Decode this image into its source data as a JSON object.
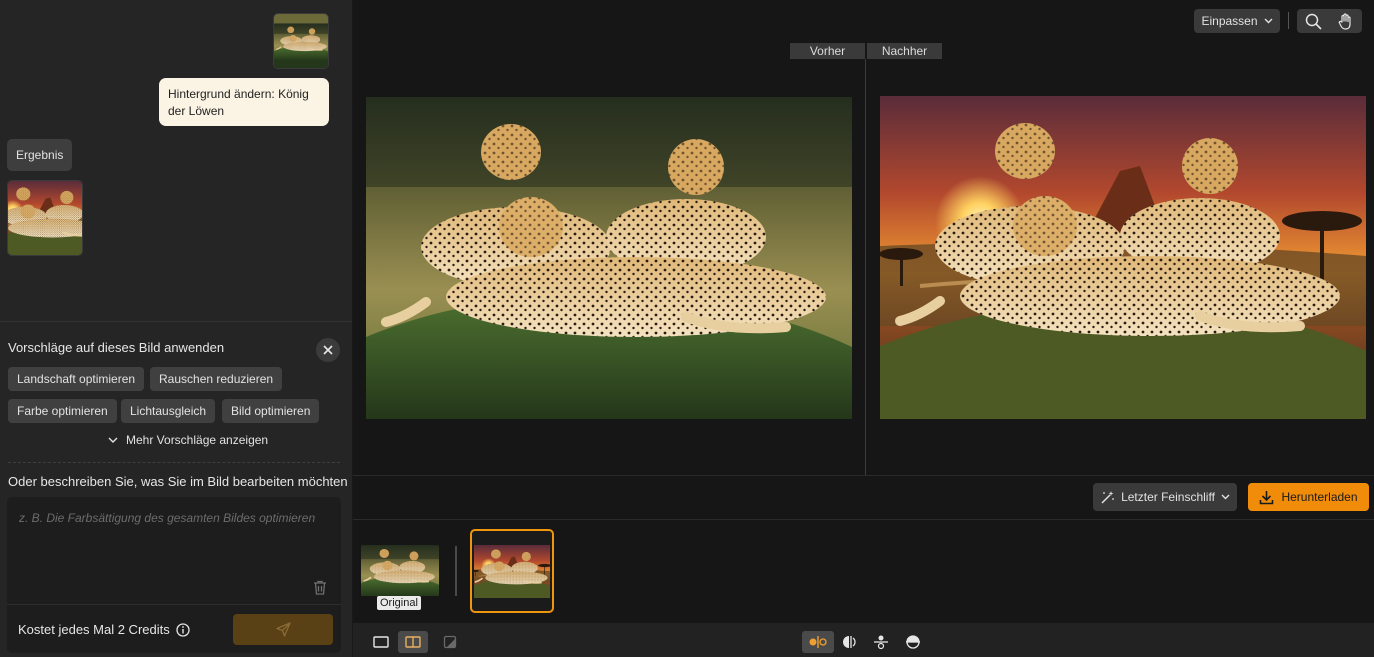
{
  "chat": {
    "user_message": "Hintergrund ändern: König der Löwen",
    "result_label": "Ergebnis"
  },
  "suggestions": {
    "title": "Vorschläge auf dieses Bild anwenden",
    "chips": [
      "Landschaft optimieren",
      "Rauschen reduzieren",
      "Farbe optimieren",
      "Lichtausgleich",
      "Bild optimieren"
    ],
    "more_label": "Mehr Vorschläge anzeigen"
  },
  "prompt": {
    "heading": "Oder beschreiben Sie, was Sie im Bild bearbeiten möchten",
    "placeholder": "z. B. Die Farbsättigung des gesamten Bildes optimieren",
    "cost_text": "Kostet jedes Mal 2 Credits"
  },
  "toolbar": {
    "zoom_label": "Einpassen"
  },
  "compare": {
    "before_label": "Vorher",
    "after_label": "Nachher"
  },
  "actions": {
    "finish_label": "Letzter Feinschliff",
    "download_label": "Herunterladen"
  },
  "filmstrip": {
    "original_label": "Original"
  },
  "colors": {
    "accent": "#f08c0a",
    "panel": "#252525",
    "canvas": "#161616"
  }
}
